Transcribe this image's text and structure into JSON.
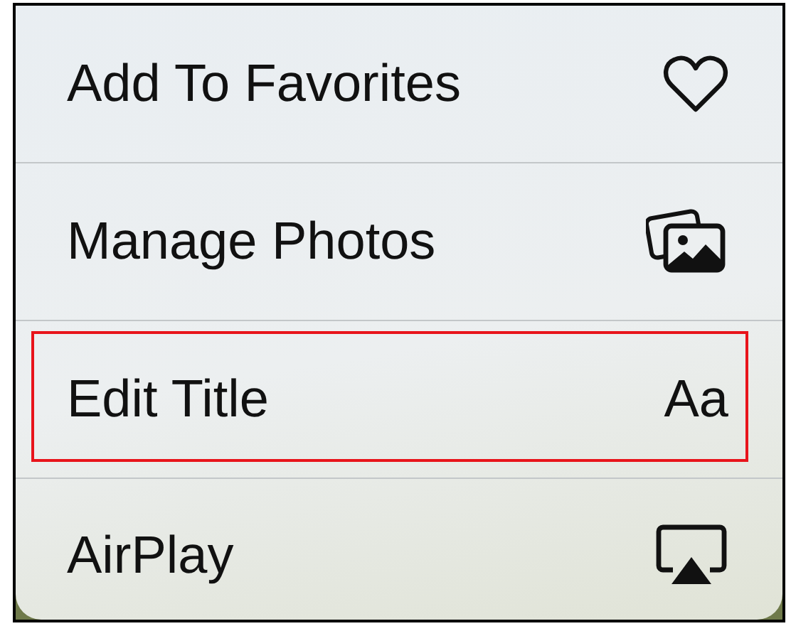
{
  "menu": {
    "items": [
      {
        "label": "Add To Favorites",
        "kind": "heart",
        "highlighted": false
      },
      {
        "label": "Manage Photos",
        "kind": "photos",
        "highlighted": false
      },
      {
        "label": "Edit Title",
        "kind": "text",
        "glyph": "Aa",
        "highlighted": true
      },
      {
        "label": "AirPlay",
        "kind": "airplay",
        "highlighted": false
      }
    ]
  }
}
